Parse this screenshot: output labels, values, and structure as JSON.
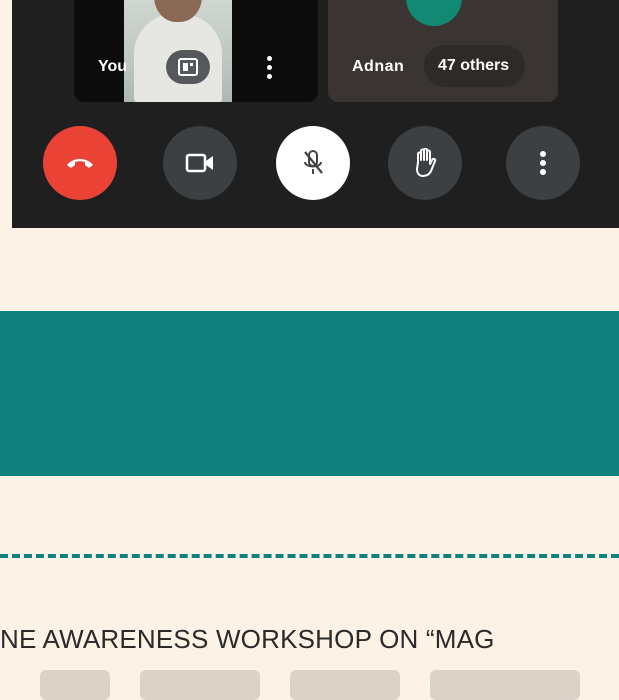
{
  "meeting": {
    "self_tile": {
      "label": "You"
    },
    "others_tile": {
      "name_label": "Adnan",
      "others_chip": "47 others",
      "avatar_color": "#128a73"
    },
    "controls": [
      {
        "name": "end-call-button",
        "icon": "phone-hangup-icon",
        "color": "#ea4335"
      },
      {
        "name": "camera-button",
        "icon": "video-camera-icon",
        "color": "#3c4043"
      },
      {
        "name": "microphone-button",
        "icon": "mic-off-icon",
        "color": "#ffffff"
      },
      {
        "name": "raise-hand-button",
        "icon": "hand-icon",
        "color": "#3c4043"
      },
      {
        "name": "more-options-button",
        "icon": "more-vertical-icon",
        "color": "#3c4043"
      }
    ]
  },
  "page": {
    "accent_color": "#10817c",
    "background_color": "#fcf2e6",
    "body_text_line": "NE AWARENESS WORKSHOP ON “MAG"
  }
}
